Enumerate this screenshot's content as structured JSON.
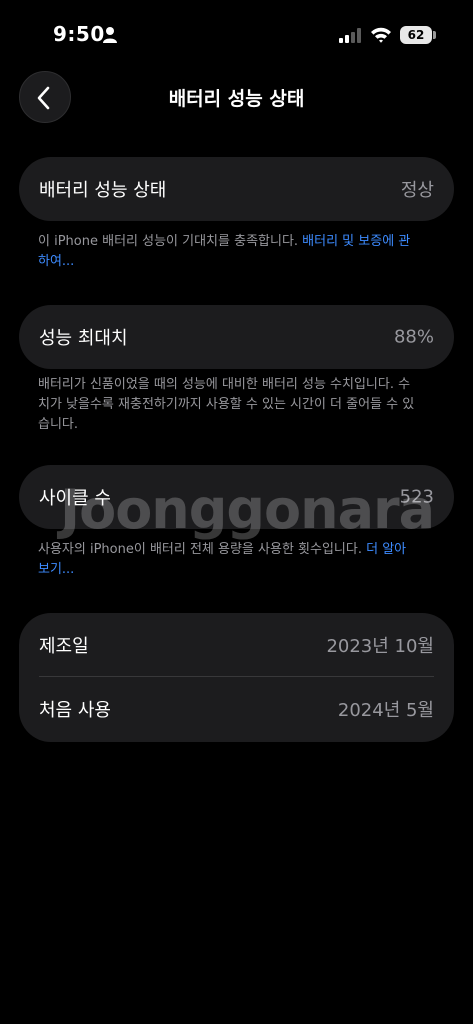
{
  "status_bar": {
    "time": "9:50",
    "battery_level": "62"
  },
  "nav": {
    "title": "배터리 성능 상태"
  },
  "battery_health": {
    "label": "배터리 성능 상태",
    "value": "정상",
    "note": "이 iPhone 배터리 성능이 기대치를 충족합니다. ",
    "note_link": "배터리 및 보증에 관하여..."
  },
  "max_capacity": {
    "label": "성능 최대치",
    "value": "88%",
    "note": "배터리가 신품이었을 때의 성능에 대비한 배터리 성능 수치입니다. 수치가 낮을수록 재충전하기까지 사용할 수 있는 시간이 더 줄어들 수 있습니다."
  },
  "cycle_count": {
    "label": "사이클 수",
    "value": "523",
    "note": "사용자의 iPhone이 배터리 전체 용량을 사용한 횟수입니다. ",
    "note_link": "더 알아보기..."
  },
  "dates": {
    "manufacture_label": "제조일",
    "manufacture_value": "2023년 10월",
    "first_use_label": "처음 사용",
    "first_use_value": "2024년 5월"
  },
  "watermark": "Joonggonara",
  "colors": {
    "background": "#000000",
    "card": "#1c1c1e",
    "secondary_text": "#98989d",
    "link": "#3d8bff"
  }
}
